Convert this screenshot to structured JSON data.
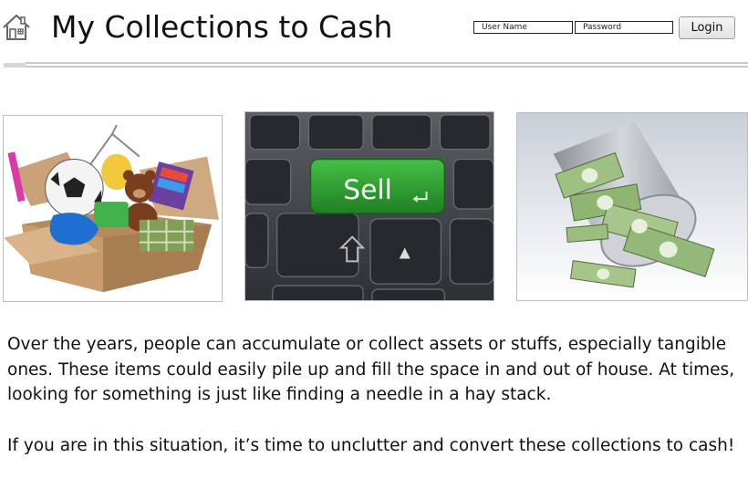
{
  "header": {
    "home_icon": "home-icon",
    "title": "My Collections to Cash"
  },
  "login": {
    "username_placeholder": "User Name",
    "password_placeholder": "Password",
    "login_label": "Login"
  },
  "images": [
    {
      "name": "box-of-collectibles-image",
      "subject": "open cardboard box with soccer ball, teddy bear and toys"
    },
    {
      "name": "sell-key-keyboard-image",
      "subject": "keyboard with green key",
      "key_label": "Sell"
    },
    {
      "name": "cash-bucket-image",
      "subject": "tipped bucket spilling dollar bills"
    }
  ],
  "content": {
    "intro": "Over the years, people can accumulate or collect assets or stuffs, especially tangible ones. These items could easily pile up and fill the space in and out of house. At times, looking for something is just like finding a needle in a hay stack.",
    "cta": "If you are in this situation, it’s time to unclutter and convert these collections to cash!"
  },
  "colors": {
    "sell_key": "#2f9a2f",
    "cash": "#7aa05a"
  }
}
